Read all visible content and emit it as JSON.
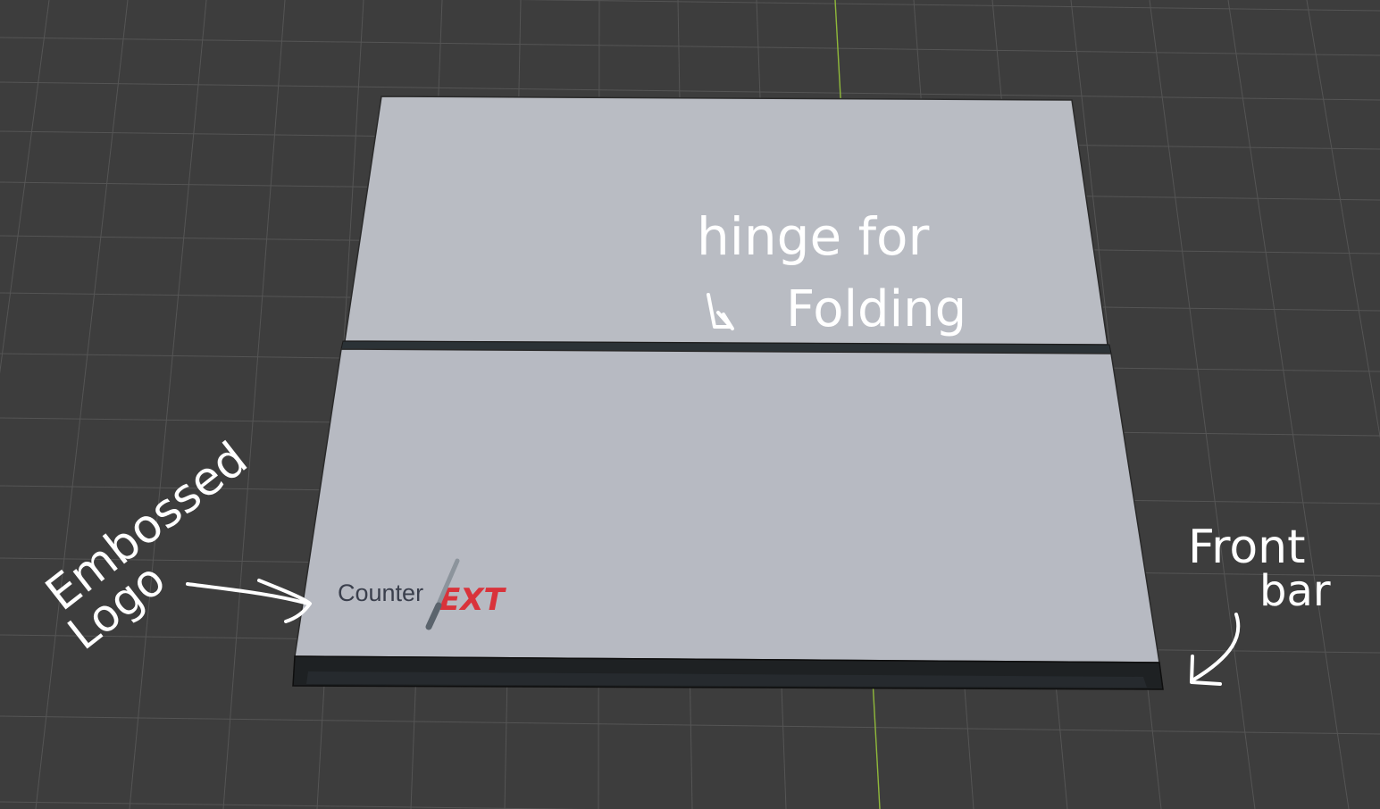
{
  "scene": {
    "viewport_color": "#3d3d3d",
    "grid_color": "#555555",
    "axis_color": "#8fb83a",
    "panel_color": "#b9bcc3",
    "bar_color": "#1e2123"
  },
  "logo": {
    "word": "Counter",
    "mark": "EXT",
    "icon": "knife-icon",
    "accent_color": "#d9333b"
  },
  "annotations": {
    "hinge_line1": "hinge for",
    "hinge_line2": "Folding",
    "logo_line1": "Embossed",
    "logo_line2": "Logo",
    "bar_line1": "Front",
    "bar_line2": "bar"
  }
}
